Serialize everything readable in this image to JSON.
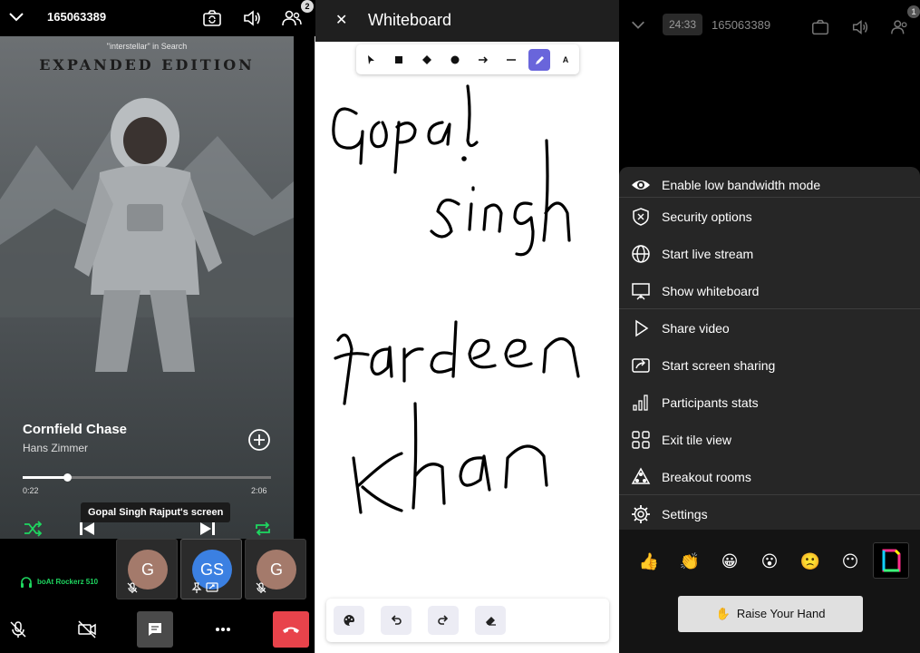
{
  "left": {
    "room_id": "165063389",
    "participants_badge": "2",
    "search_note": "\"interstellar\" in Search",
    "poster_caption": "EXPANDED EDITION",
    "track": {
      "title": "Cornfield Chase",
      "artist": "Hans Zimmer",
      "elapsed": "0:22",
      "total": "2:06",
      "progress": 0.18
    },
    "screen_label": "Gopal Singh Rajput's screen",
    "device": "boAt Rockerz 510",
    "tiles": [
      {
        "initial": "G",
        "color": "#a47a6b"
      },
      {
        "initial": "GS",
        "color": "#3b80e2"
      },
      {
        "initial": "G",
        "color": "#a47a6b"
      }
    ],
    "colors": {
      "spotify_green": "#1ed760",
      "hangup_red": "#e8434b"
    }
  },
  "whiteboard": {
    "title": "Whiteboard",
    "close_icon": "close-icon",
    "tools": [
      "select-icon",
      "rectangle-icon",
      "diamond-icon",
      "ellipse-icon",
      "arrow-icon",
      "line-icon",
      "pencil-icon",
      "text-icon"
    ],
    "text_tool_label": "A",
    "active_tool": "pencil",
    "accent": "#6965db",
    "handwriting": [
      "Gopal",
      "Singh",
      "Fardeen",
      "Khan"
    ],
    "footer_tools": [
      "palette-icon",
      "undo-icon",
      "redo-icon",
      "eraser-icon"
    ]
  },
  "right": {
    "timer": "24:33",
    "room_id": "165063389",
    "participants_badge": "1",
    "menu": [
      {
        "label": "Enable low bandwidth mode",
        "icon": "eye-icon"
      },
      {
        "label": "Security options",
        "icon": "shield-icon"
      },
      {
        "label": "Start live stream",
        "icon": "globe-icon"
      },
      {
        "label": "Show whiteboard",
        "icon": "presentation-icon"
      },
      {
        "label": "Share video",
        "icon": "play-icon"
      },
      {
        "label": "Start screen sharing",
        "icon": "screen-share-icon"
      },
      {
        "label": "Participants stats",
        "icon": "bars-icon"
      },
      {
        "label": "Exit tile view",
        "icon": "grid-icon"
      },
      {
        "label": "Breakout rooms",
        "icon": "breakout-icon"
      },
      {
        "label": "Settings",
        "icon": "gear-icon"
      }
    ],
    "reactions": [
      "👍",
      "👏",
      "😀",
      "😮",
      "🙁",
      "😶"
    ],
    "raise_hand": {
      "emoji": "✋",
      "label": "Raise Your Hand"
    }
  }
}
